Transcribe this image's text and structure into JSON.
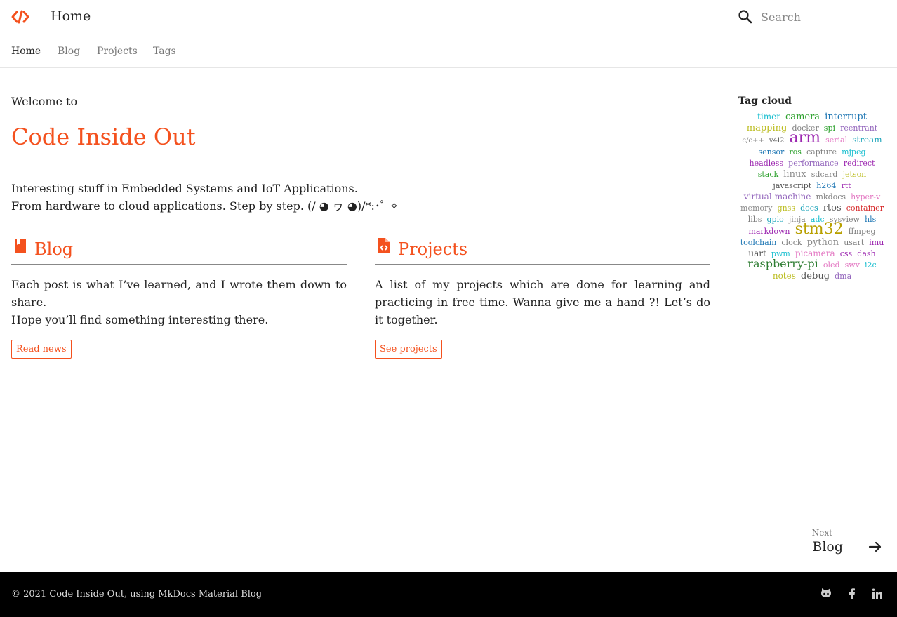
{
  "header": {
    "title": "Home",
    "search_placeholder": "Search",
    "logo_icon": "code-icon",
    "accent_color": "#f4511e"
  },
  "tabs": [
    {
      "label": "Home",
      "active": true
    },
    {
      "label": "Blog",
      "active": false
    },
    {
      "label": "Projects",
      "active": false
    },
    {
      "label": "Tags",
      "active": false
    }
  ],
  "hero": {
    "welcome": "Welcome to",
    "title": "Code Inside Out",
    "line1": "Interesting stuff in Embedded Systems and IoT Applications.",
    "line2": "From hardware to cloud applications. Step by step. (/ ◕ ヮ ◕)/*:･ﾟ ✧"
  },
  "cards": [
    {
      "title": "Blog",
      "icon": "bookmark-icon",
      "line1": "Each post is what I’ve learned, and I wrote them down to share.",
      "line2": "Hope you’ll find something interesting there.",
      "button": "Read news"
    },
    {
      "title": "Projects",
      "icon": "file-code-icon",
      "text": "A list of my projects which are done for learning and practicing in free time. Wanna give me a hand ?! Let’s do it together.",
      "button": "See projects"
    }
  ],
  "tag_cloud": {
    "title": "Tag cloud",
    "tags": [
      {
        "name": "timer",
        "size": 12,
        "color": "#17becf"
      },
      {
        "name": "camera",
        "size": 13,
        "color": "#2ca02c"
      },
      {
        "name": "interrupt",
        "size": 13,
        "color": "#1f77b4"
      },
      {
        "name": "mapping",
        "size": 13,
        "color": "#bcbd22"
      },
      {
        "name": "docker",
        "size": 11,
        "color": "#7f7f7f"
      },
      {
        "name": "spi",
        "size": 11,
        "color": "#2ca02c"
      },
      {
        "name": "reentrant",
        "size": 11,
        "color": "#9467bd"
      },
      {
        "name": "c/c++",
        "size": 10,
        "color": "#8c8c8c"
      },
      {
        "name": "v4l2",
        "size": 10,
        "color": "#555555"
      },
      {
        "name": "arm",
        "size": 22,
        "color": "#9c27b0"
      },
      {
        "name": "serial",
        "size": 11,
        "color": "#e377c2"
      },
      {
        "name": "stream",
        "size": 12,
        "color": "#17a2b8"
      },
      {
        "name": "sensor",
        "size": 11,
        "color": "#1f77b4"
      },
      {
        "name": "ros",
        "size": 11,
        "color": "#2ca02c"
      },
      {
        "name": "capture",
        "size": 11,
        "color": "#7f7f7f"
      },
      {
        "name": "mjpeg",
        "size": 11,
        "color": "#17becf"
      },
      {
        "name": "headless",
        "size": 11,
        "color": "#9c27b0"
      },
      {
        "name": "performance",
        "size": 11,
        "color": "#9467bd"
      },
      {
        "name": "redirect",
        "size": 11,
        "color": "#9c27b0"
      },
      {
        "name": "stack",
        "size": 11,
        "color": "#2ca02c"
      },
      {
        "name": "linux",
        "size": 13,
        "color": "#8c8c8c"
      },
      {
        "name": "sdcard",
        "size": 11,
        "color": "#7f7f7f"
      },
      {
        "name": "jetson",
        "size": 11,
        "color": "#bcbd22"
      },
      {
        "name": "javascript",
        "size": 11,
        "color": "#555555"
      },
      {
        "name": "h264",
        "size": 11,
        "color": "#1f77b4"
      },
      {
        "name": "rtt",
        "size": 11,
        "color": "#9c27b0"
      },
      {
        "name": "virtual-machine",
        "size": 12,
        "color": "#9467bd"
      },
      {
        "name": "mkdocs",
        "size": 11,
        "color": "#7f7f7f"
      },
      {
        "name": "hyper-v",
        "size": 11,
        "color": "#e377c2"
      },
      {
        "name": "memory",
        "size": 11,
        "color": "#8c8c8c"
      },
      {
        "name": "gnss",
        "size": 11,
        "color": "#bcbd22"
      },
      {
        "name": "docs",
        "size": 11,
        "color": "#17a2b8"
      },
      {
        "name": "rtos",
        "size": 13,
        "color": "#555555"
      },
      {
        "name": "container",
        "size": 11,
        "color": "#d62728"
      },
      {
        "name": "libs",
        "size": 11,
        "color": "#7f7f7f"
      },
      {
        "name": "gpio",
        "size": 11,
        "color": "#17a2b8"
      },
      {
        "name": "jinja",
        "size": 11,
        "color": "#8c8c8c"
      },
      {
        "name": "adc",
        "size": 11,
        "color": "#17becf"
      },
      {
        "name": "sysview",
        "size": 11,
        "color": "#7f7f7f"
      },
      {
        "name": "hls",
        "size": 11,
        "color": "#1f77b4"
      },
      {
        "name": "markdown",
        "size": 11,
        "color": "#9c27b0"
      },
      {
        "name": "stm32",
        "size": 22,
        "color": "#b8a000"
      },
      {
        "name": "ffmpeg",
        "size": 11,
        "color": "#7f7f7f"
      },
      {
        "name": "toolchain",
        "size": 11,
        "color": "#1f77b4"
      },
      {
        "name": "clock",
        "size": 11,
        "color": "#7f7f7f"
      },
      {
        "name": "python",
        "size": 13,
        "color": "#8c8c8c"
      },
      {
        "name": "usart",
        "size": 11,
        "color": "#7f7f7f"
      },
      {
        "name": "imu",
        "size": 11,
        "color": "#9c27b0"
      },
      {
        "name": "uart",
        "size": 12,
        "color": "#555555"
      },
      {
        "name": "pwm",
        "size": 11,
        "color": "#17becf"
      },
      {
        "name": "picamera",
        "size": 12,
        "color": "#e377c2"
      },
      {
        "name": "css",
        "size": 11,
        "color": "#9c27b0"
      },
      {
        "name": "dash",
        "size": 11,
        "color": "#9c27b0"
      },
      {
        "name": "raspberry-pi",
        "size": 16,
        "color": "#2e7d32"
      },
      {
        "name": "oled",
        "size": 11,
        "color": "#e377c2"
      },
      {
        "name": "swv",
        "size": 11,
        "color": "#e377c2"
      },
      {
        "name": "i2c",
        "size": 11,
        "color": "#17becf"
      },
      {
        "name": "notes",
        "size": 12,
        "color": "#bcbd22"
      },
      {
        "name": "debug",
        "size": 13,
        "color": "#555555"
      },
      {
        "name": "dma",
        "size": 11,
        "color": "#9467bd"
      }
    ]
  },
  "next": {
    "label": "Next",
    "title": "Blog",
    "icon": "arrow-right-icon"
  },
  "footer": {
    "copyright": "© 2021 Code Inside Out, using MkDocs Material Blog",
    "icons": [
      "github-icon",
      "facebook-icon",
      "linkedin-icon"
    ]
  }
}
